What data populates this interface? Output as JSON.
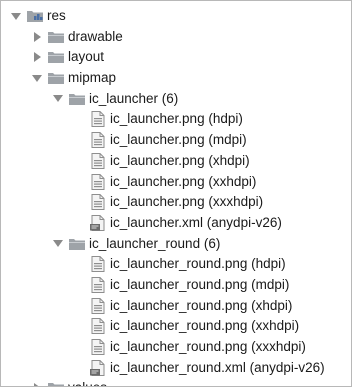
{
  "tree": {
    "root": {
      "label": "res",
      "icon": "resource-folder-icon",
      "expanded": true
    },
    "drawable": {
      "label": "drawable",
      "icon": "folder-icon",
      "expanded": false
    },
    "layout": {
      "label": "layout",
      "icon": "folder-icon",
      "expanded": false
    },
    "mipmap": {
      "label": "mipmap",
      "icon": "folder-icon",
      "expanded": true
    },
    "ic_launcher": {
      "label": "ic_launcher (6)",
      "icon": "folder-icon",
      "expanded": true,
      "files": [
        {
          "label": "ic_launcher.png (hdpi)",
          "icon": "image-file-icon"
        },
        {
          "label": "ic_launcher.png (mdpi)",
          "icon": "image-file-icon"
        },
        {
          "label": "ic_launcher.png (xhdpi)",
          "icon": "image-file-icon"
        },
        {
          "label": "ic_launcher.png (xxhdpi)",
          "icon": "image-file-icon"
        },
        {
          "label": "ic_launcher.png (xxxhdpi)",
          "icon": "image-file-icon"
        },
        {
          "label": "ic_launcher.xml (anydpi-v26)",
          "icon": "xml-file-icon"
        }
      ]
    },
    "ic_launcher_round": {
      "label": "ic_launcher_round (6)",
      "icon": "folder-icon",
      "expanded": true,
      "files": [
        {
          "label": "ic_launcher_round.png (hdpi)",
          "icon": "image-file-icon"
        },
        {
          "label": "ic_launcher_round.png (mdpi)",
          "icon": "image-file-icon"
        },
        {
          "label": "ic_launcher_round.png (xhdpi)",
          "icon": "image-file-icon"
        },
        {
          "label": "ic_launcher_round.png (xxhdpi)",
          "icon": "image-file-icon"
        },
        {
          "label": "ic_launcher_round.png (xxxhdpi)",
          "icon": "image-file-icon"
        },
        {
          "label": "ic_launcher_round.xml (anydpi-v26)",
          "icon": "xml-file-icon"
        }
      ]
    },
    "values": {
      "label": "values",
      "icon": "folder-icon",
      "expanded": false
    }
  },
  "colors": {
    "arrow": "#8a8a8a",
    "folder": "#9ea3a8",
    "text": "#1a1a1a"
  }
}
